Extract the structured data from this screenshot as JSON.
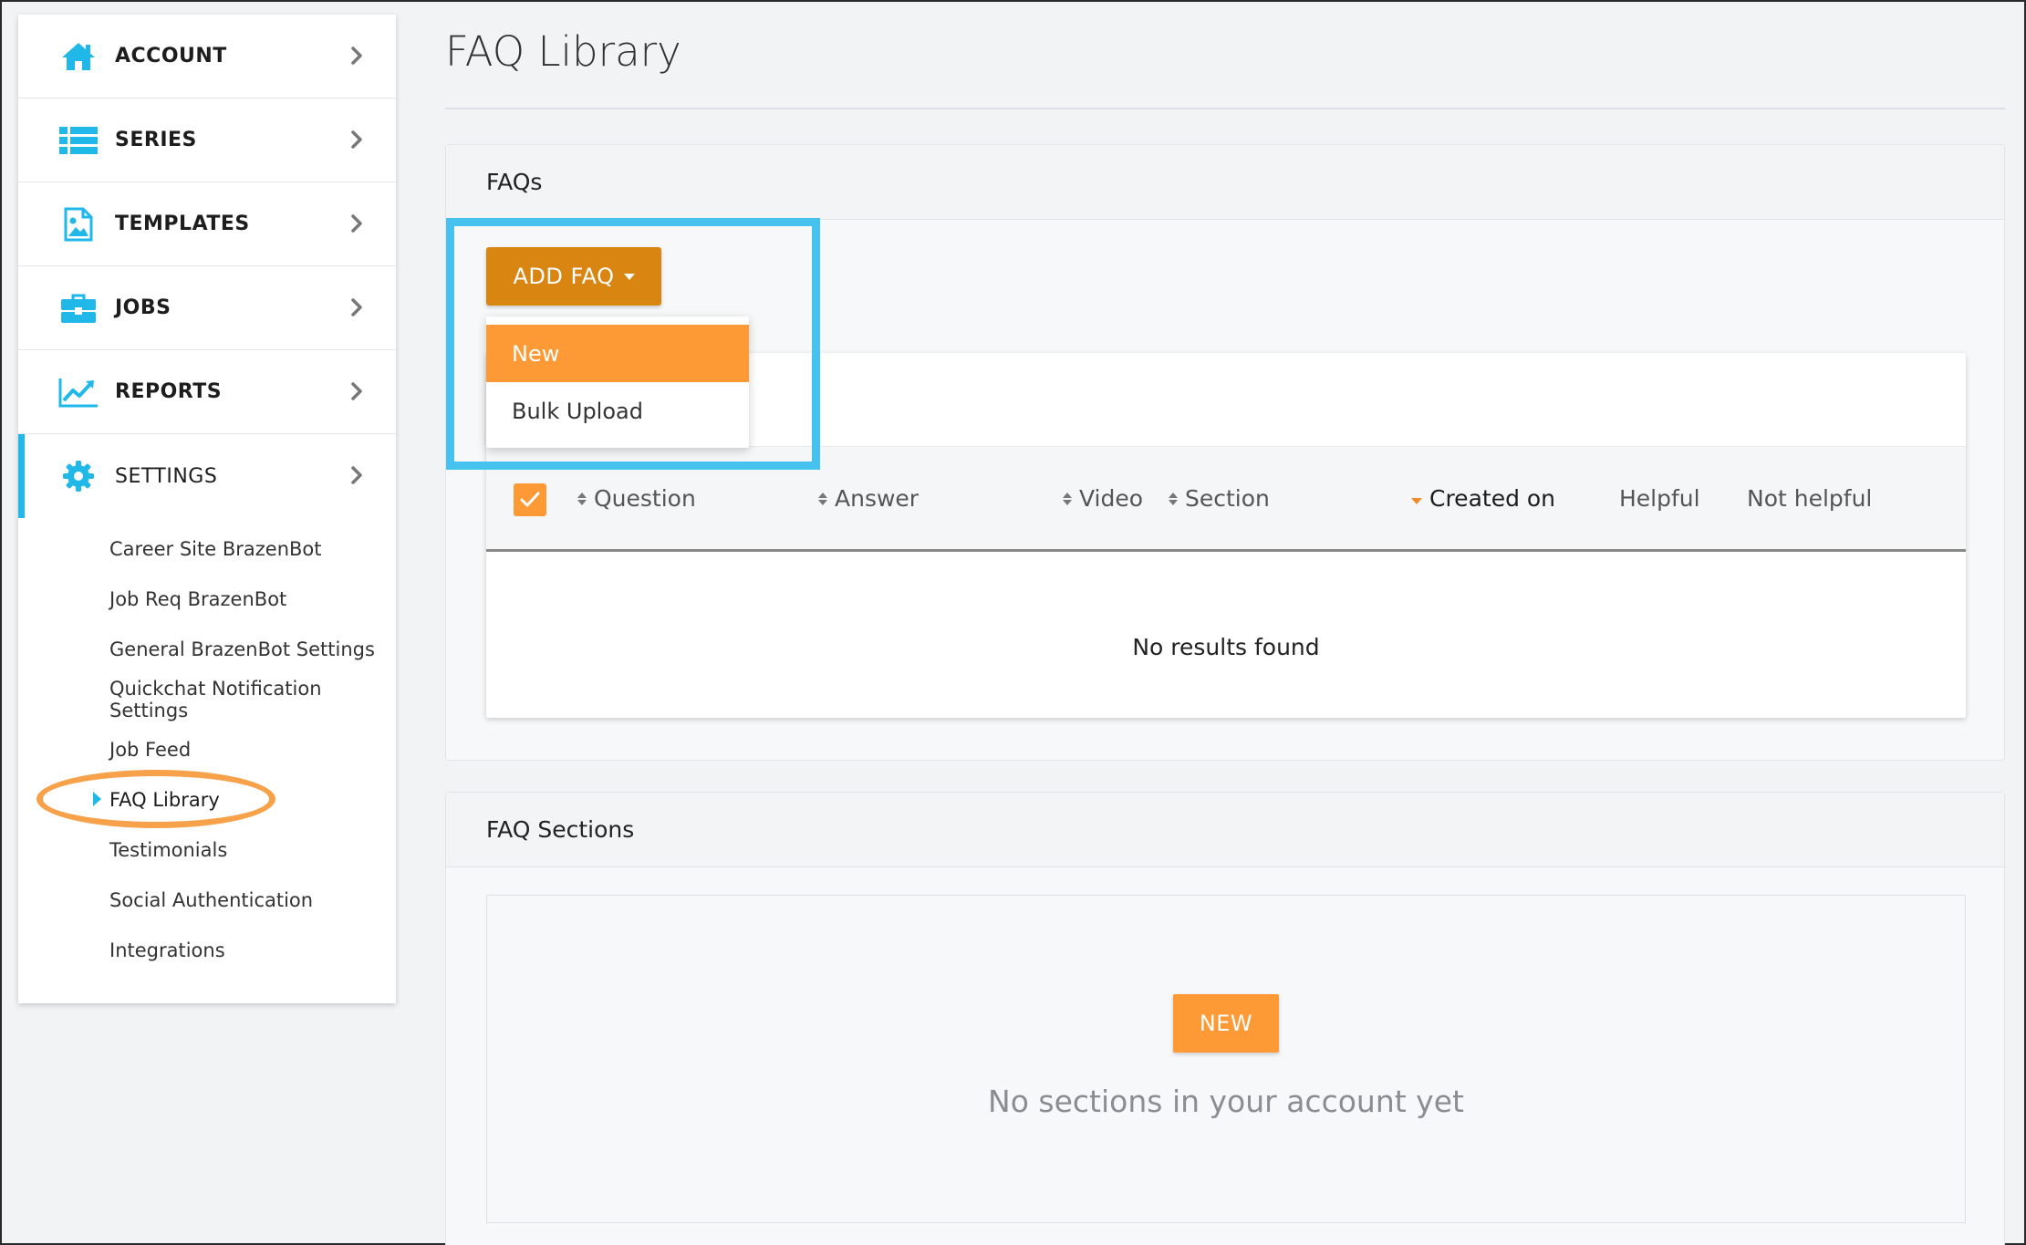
{
  "sidebar": {
    "items": [
      {
        "label": "ACCOUNT",
        "icon": "home-icon"
      },
      {
        "label": "SERIES",
        "icon": "list-icon"
      },
      {
        "label": "TEMPLATES",
        "icon": "image-file-icon"
      },
      {
        "label": "JOBS",
        "icon": "briefcase-icon"
      },
      {
        "label": "REPORTS",
        "icon": "line-chart-icon"
      },
      {
        "label": "SETTINGS",
        "icon": "gear-icon"
      }
    ],
    "settings_subitems": [
      "Career Site BrazenBot",
      "Job Req BrazenBot",
      "General BrazenBot Settings",
      "Quickchat Notification Settings",
      "Job Feed",
      "FAQ Library",
      "Testimonials",
      "Social Authentication",
      "Integrations"
    ],
    "current_subitem": "FAQ Library"
  },
  "page": {
    "title": "FAQ Library"
  },
  "faqs_panel": {
    "title": "FAQs",
    "add_button_label": "ADD FAQ",
    "dropdown": {
      "items": [
        "New",
        "Bulk Upload"
      ],
      "selected": "New"
    },
    "table": {
      "columns": [
        "Question",
        "Answer",
        "Video",
        "Section",
        "Created on",
        "Helpful",
        "Not helpful"
      ],
      "sorted_column": "Created on",
      "sort_direction": "desc",
      "select_all_checked": true,
      "empty_text": "No results found"
    }
  },
  "sections_panel": {
    "title": "FAQ Sections",
    "new_button_label": "NEW",
    "empty_text": "No sections in your account yet"
  },
  "colors": {
    "accent_blue": "#1fb8e8",
    "orange_primary": "#fd9a35",
    "orange_dark": "#d98512",
    "highlight_box": "#45c3ee",
    "highlight_ellipse": "#f7a14a"
  }
}
